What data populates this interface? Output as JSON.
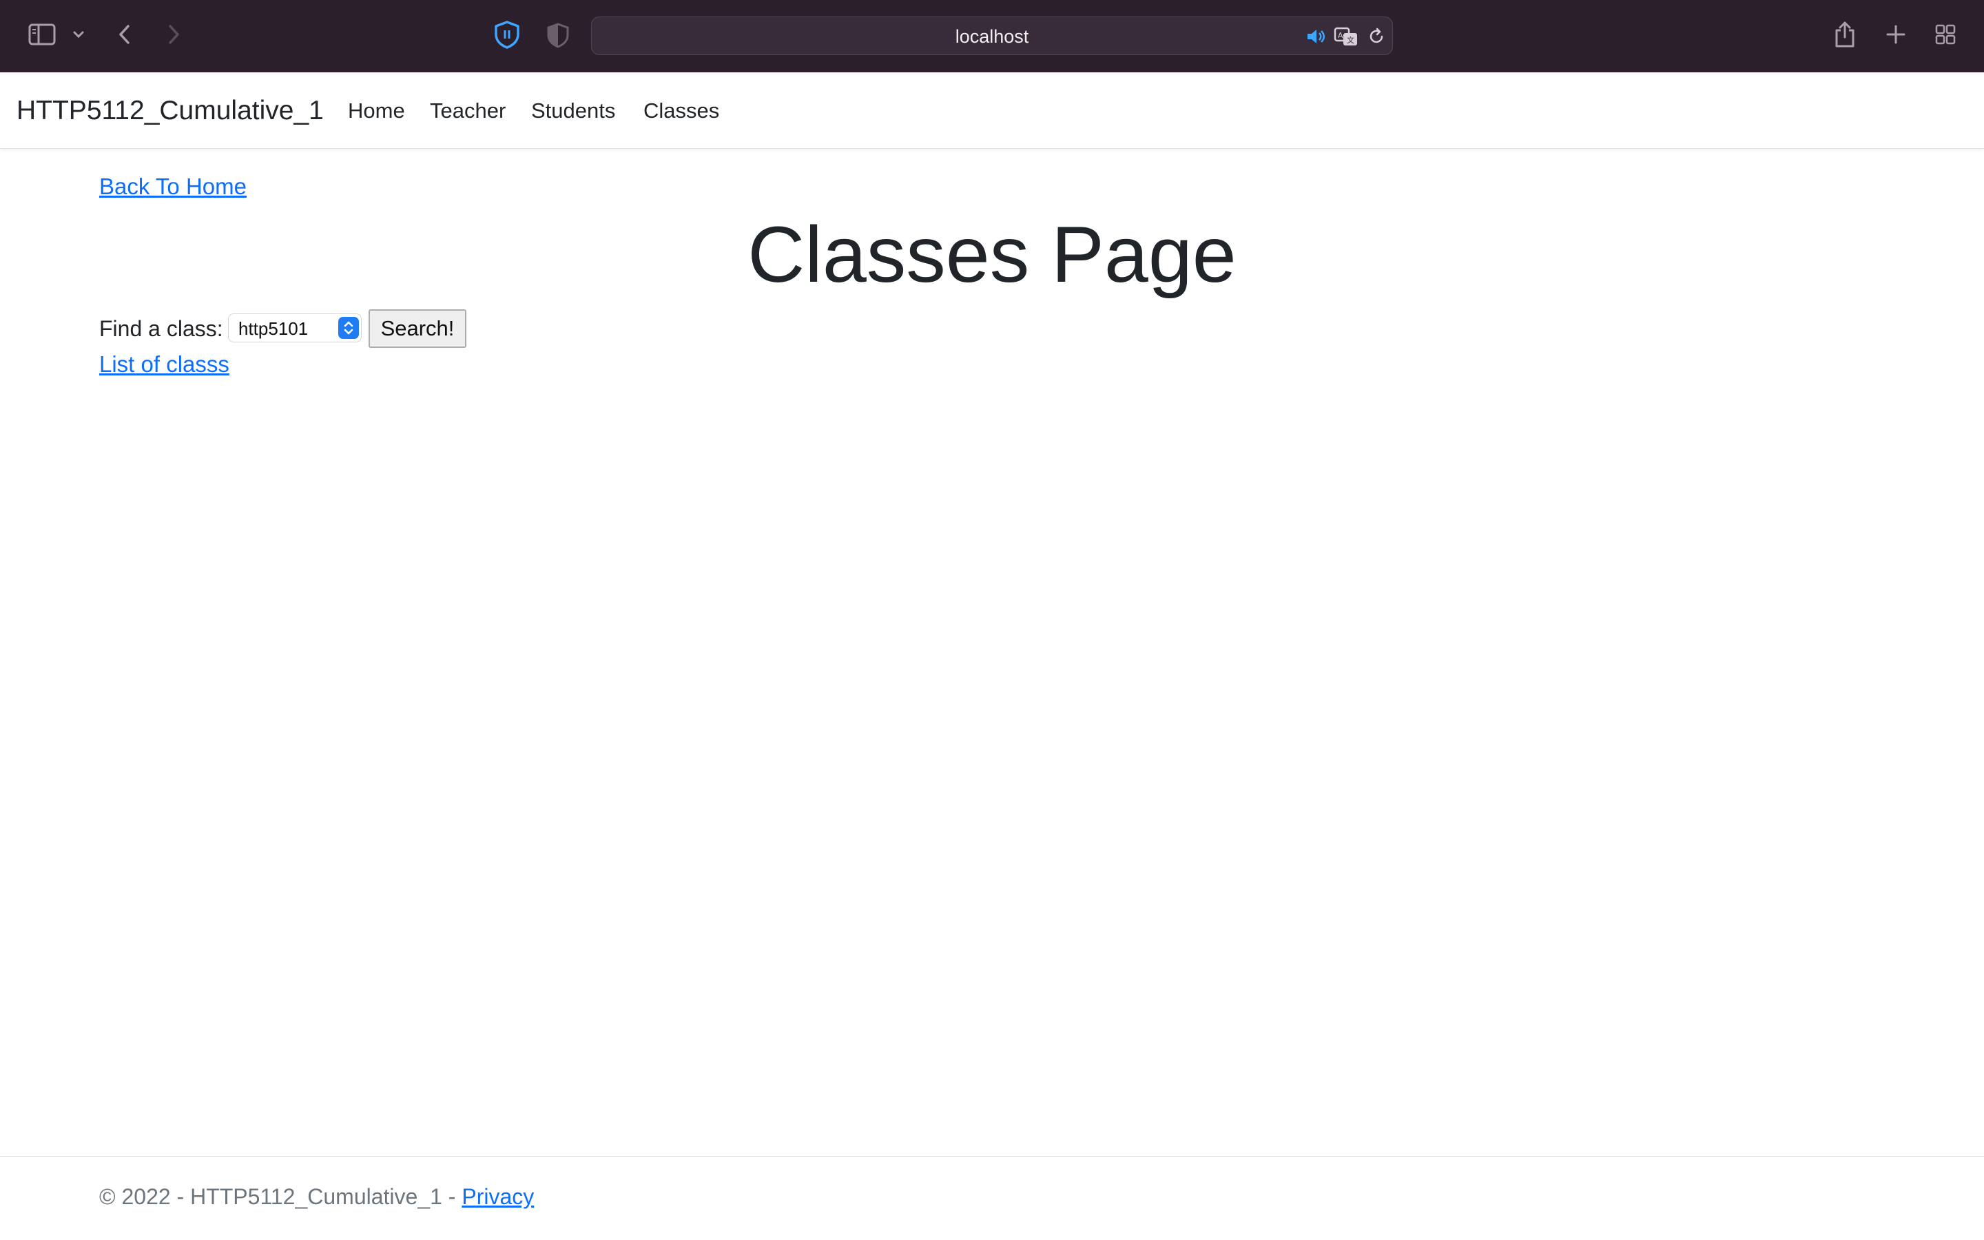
{
  "browser": {
    "url": "localhost",
    "accent_color": "#3ea6ff",
    "icons": [
      "sidebar-icon",
      "chevron-down-icon",
      "back-arrow-icon",
      "forward-arrow-icon",
      "shield-privacy-icon",
      "half-shield-icon",
      "speaker-icon",
      "translate-icon",
      "reload-icon",
      "share-icon",
      "plus-icon",
      "tabs-grid-icon"
    ]
  },
  "navbar": {
    "brand": "HTTP5112_Cumulative_1",
    "links": [
      "Home",
      "Teacher",
      "Students",
      "Classes"
    ]
  },
  "main": {
    "back_link": "Back To Home",
    "title": "Classes Page",
    "find_label": "Find a class:",
    "select_value": "http5101",
    "search_button": "Search!",
    "list_link": "List of classs"
  },
  "footer": {
    "text": "© 2022 - HTTP5112_Cumulative_1 - ",
    "privacy_link": "Privacy"
  },
  "colors": {
    "link": "#0d6efd",
    "chrome_bg": "#2b1f2c",
    "select_arrow": "#1f7cf2"
  }
}
